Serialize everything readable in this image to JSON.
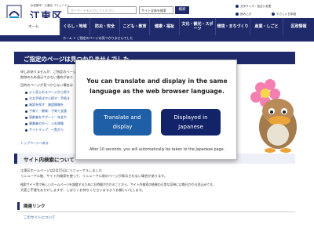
{
  "header": {
    "logo_tagline": "水彩都市・江東区 コミュニティ",
    "logo_text": "江東区",
    "logo_sub": "KOTO CITY",
    "search_placeholder": "キーワードを入力してください",
    "site_search_option": "サイト全体を検索",
    "search_button": "検索",
    "links": [
      "文字サイズ・色合い変更",
      "読み上げ",
      "Foreign Language",
      "やさしい日本語"
    ]
  },
  "nav": {
    "home": "ホーム",
    "items": [
      "くらし・地域",
      "防災・安全",
      "こども・教育",
      "健康・福祉",
      "文化・観光・スポーツ",
      "環境・まちづくり",
      "産業・しごと",
      "区政情報"
    ]
  },
  "breadcrumb": "ホーム > ご指定のページは見つかりませんでした",
  "main": {
    "title": "ご指定のページは見つかりませんでした",
    "paragraphs": [
      "申し訳ありませんが、ご指定のページ",
      "削除のため表示できない場合があり",
      "目的のページが見つからない場合は"
    ],
    "list": [
      "よく見られるページから探す",
      "主な手続きから探す：手続き",
      "施設を探す：施設情報を",
      "子育て・教育：子育て支援",
      "高齢者をサポート：年金や",
      "事業者の方へ：入札情報",
      "サイトマップ：一覧から"
    ],
    "top_link": "トップページへ戻る",
    "section_title": "サイト内検索について",
    "section_paragraphs": [
      "江東区ホームページは2月15日にリニューアルしました",
      "リニューアル後、サイト内検索を使って、リニューアル前のページが表示されない場合があります。",
      "検索サイト等で新しいホームページを調整するためにお時間がかかることから、サイト内検索の結果の正常な反映には数日かかる見込みです。",
      "大変ご不便をおかけしますが、しばらくお待ちくださいますようお願いいたします。"
    ],
    "related_title": "関連リンク",
    "sitemap_link": "このサイトについて"
  },
  "modal": {
    "message": "You can translate and display in the same language as the web browser language.",
    "translate_button": "Translate and display",
    "japanese_button": "Displayed in Japanese",
    "note": "After 10 seconds, you will automatically be taken to the Japanese page."
  },
  "colors": {
    "brand_navy": "#1f2a6b",
    "translate_blue": "#1f5fa8",
    "japanese_navy": "#13236a"
  }
}
